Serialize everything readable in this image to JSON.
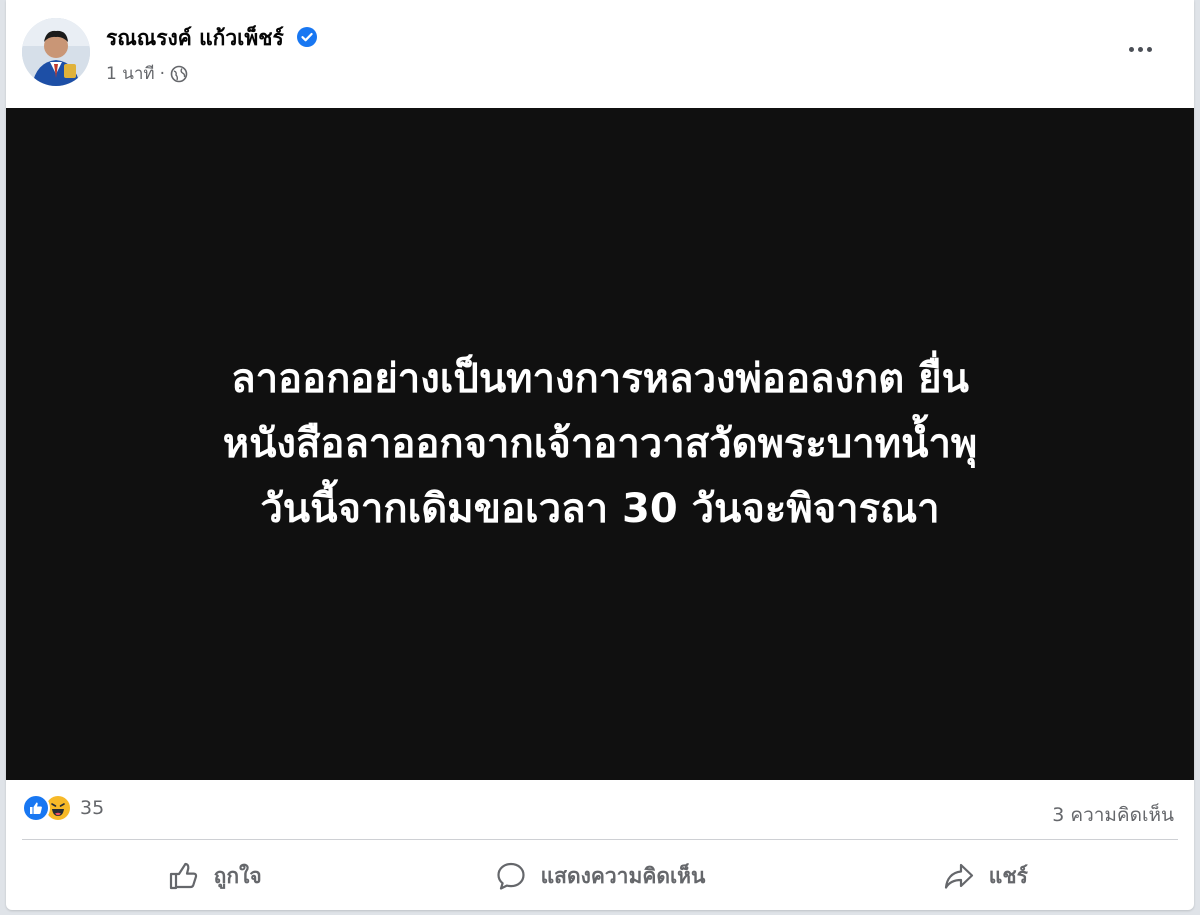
{
  "post": {
    "author": "รณณรงค์ แก้วเพ็ชร์",
    "timestamp": "1 นาที",
    "separator": "·",
    "privacy_icon": "globe-icon",
    "verified_icon": "verified-badge-icon",
    "more_icon": "more-options-icon"
  },
  "media": {
    "lines": [
      "ลาออกอย่างเป็นทางการหลวงพ่ออลงกต ยื่น",
      "หนังสือลาออกจากเจ้าอาวาสวัดพระบาทน้ำพุ",
      "วันนี้จากเดิมขอเวลา 30 วันจะพิจารณา"
    ]
  },
  "stats": {
    "reaction_count": "35",
    "reaction_icons": [
      "like-reaction-icon",
      "haha-reaction-icon"
    ],
    "comments": "3 ความคิดเห็น"
  },
  "actions": {
    "like_label": "ถูกใจ",
    "comment_label": "แสดงความคิดเห็น",
    "share_label": "แชร์"
  },
  "colors": {
    "accent": "#1877f2",
    "text_secondary": "#65676b",
    "media_bg": "#101010"
  }
}
